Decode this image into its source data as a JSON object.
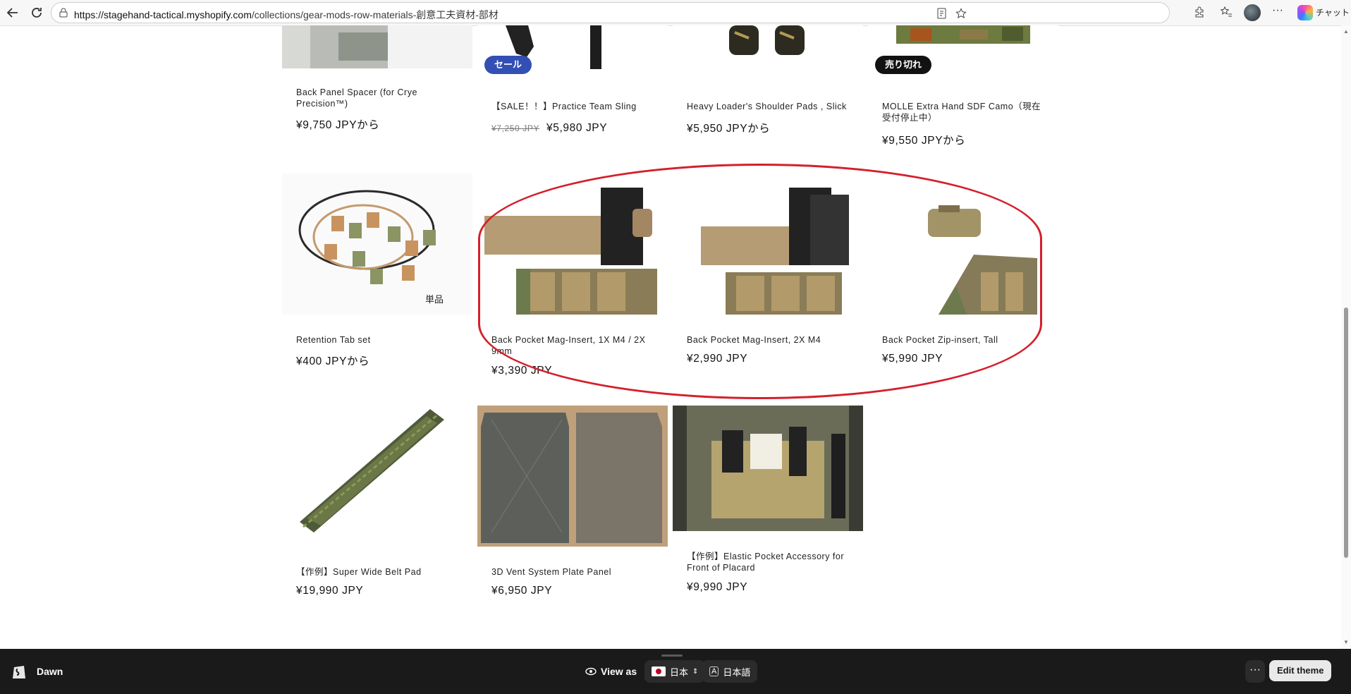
{
  "browser": {
    "url_host": "https://stagehand-tactical.myshopify.com",
    "url_path": "/collections/gear-mods-row-materials-創意工夫資材-部材",
    "chat_label": "チャット"
  },
  "products": [
    {
      "title": "Back Panel Spacer (for Crye Precision™)",
      "price": "¥9,750 JPYから",
      "old_price": "",
      "badge": ""
    },
    {
      "title": "【SALE！！】Practice Team Sling",
      "price": "¥5,980 JPY",
      "old_price": "¥7,250 JPY",
      "badge": "セール"
    },
    {
      "title": "Heavy Loader's Shoulder Pads , Slick",
      "price": "¥5,950 JPYから",
      "old_price": "",
      "badge": ""
    },
    {
      "title": "MOLLE Extra Hand SDF Camo（現在受付停止中）",
      "price": "¥9,550 JPYから",
      "old_price": "",
      "badge": "売り切れ"
    },
    {
      "title": "Retention Tab set",
      "price": "¥400 JPYから",
      "old_price": "",
      "badge": "",
      "image_caption": "単品"
    },
    {
      "title": "Back Pocket Mag-Insert, 1X M4 / 2X 9mm",
      "price": "¥3,390 JPY",
      "old_price": "",
      "badge": ""
    },
    {
      "title": "Back Pocket Mag-Insert, 2X M4",
      "price": "¥2,990 JPY",
      "old_price": "",
      "badge": ""
    },
    {
      "title": "Back Pocket Zip-insert, Tall",
      "price": "¥5,990 JPY",
      "old_price": "",
      "badge": ""
    },
    {
      "title": "【作例】Super Wide Belt Pad",
      "price": "¥19,990 JPY",
      "old_price": "",
      "badge": ""
    },
    {
      "title": "3D Vent System Plate Panel",
      "price": "¥6,950 JPY",
      "old_price": "",
      "badge": ""
    },
    {
      "title": "【作例】Elastic Pocket Accessory for Front of Placard",
      "price": "¥9,990 JPY",
      "old_price": "",
      "badge": ""
    }
  ],
  "admin_bar": {
    "theme_name": "Dawn",
    "view_as_label": "View as",
    "country": "日本",
    "language": "日本語",
    "more_label": "···",
    "edit_button": "Edit theme"
  },
  "colors": {
    "sale_badge": "#334fb4",
    "sold_badge": "#121212",
    "highlight": "#d4202b",
    "admin_bar": "#1a1a1a"
  }
}
